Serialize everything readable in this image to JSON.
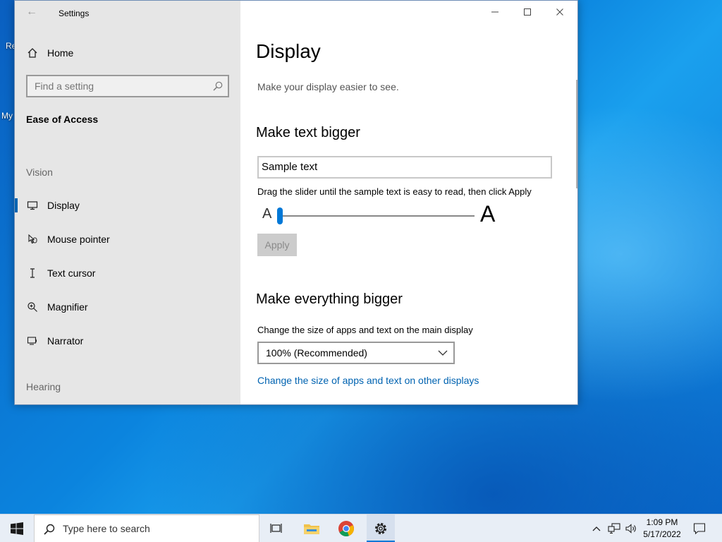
{
  "desktop": {
    "icon_labels": [
      "Re",
      "My"
    ]
  },
  "window": {
    "title": "Settings",
    "sidebar": {
      "home_label": "Home",
      "search_placeholder": "Find a setting",
      "category": "Ease of Access",
      "section_vision": "Vision",
      "section_hearing": "Hearing",
      "items": [
        {
          "label": "Display",
          "icon": "monitor-icon",
          "active": true
        },
        {
          "label": "Mouse pointer",
          "icon": "mouse-pointer-icon"
        },
        {
          "label": "Text cursor",
          "icon": "text-cursor-icon"
        },
        {
          "label": "Magnifier",
          "icon": "magnifier-icon"
        },
        {
          "label": "Narrator",
          "icon": "narrator-icon"
        }
      ]
    },
    "main": {
      "title": "Display",
      "subtitle": "Make your display easier to see.",
      "text_bigger": {
        "heading": "Make text bigger",
        "sample": "Sample text",
        "instruction": "Drag the slider until the sample text is easy to read, then click Apply",
        "small_a": "A",
        "big_a": "A",
        "slider_value": 0,
        "apply_label": "Apply"
      },
      "everything_bigger": {
        "heading": "Make everything bigger",
        "instruction": "Change the size of apps and text on the main display",
        "dropdown_value": "100% (Recommended)",
        "link_other_displays": "Change the size of apps and text on other displays"
      }
    }
  },
  "taskbar": {
    "search_placeholder": "Type here to search",
    "time": "1:09 PM",
    "date": "5/17/2022"
  },
  "colors": {
    "accent": "#0078d7",
    "link": "#0063b1",
    "sidebar_bg": "#e6e6e6"
  }
}
